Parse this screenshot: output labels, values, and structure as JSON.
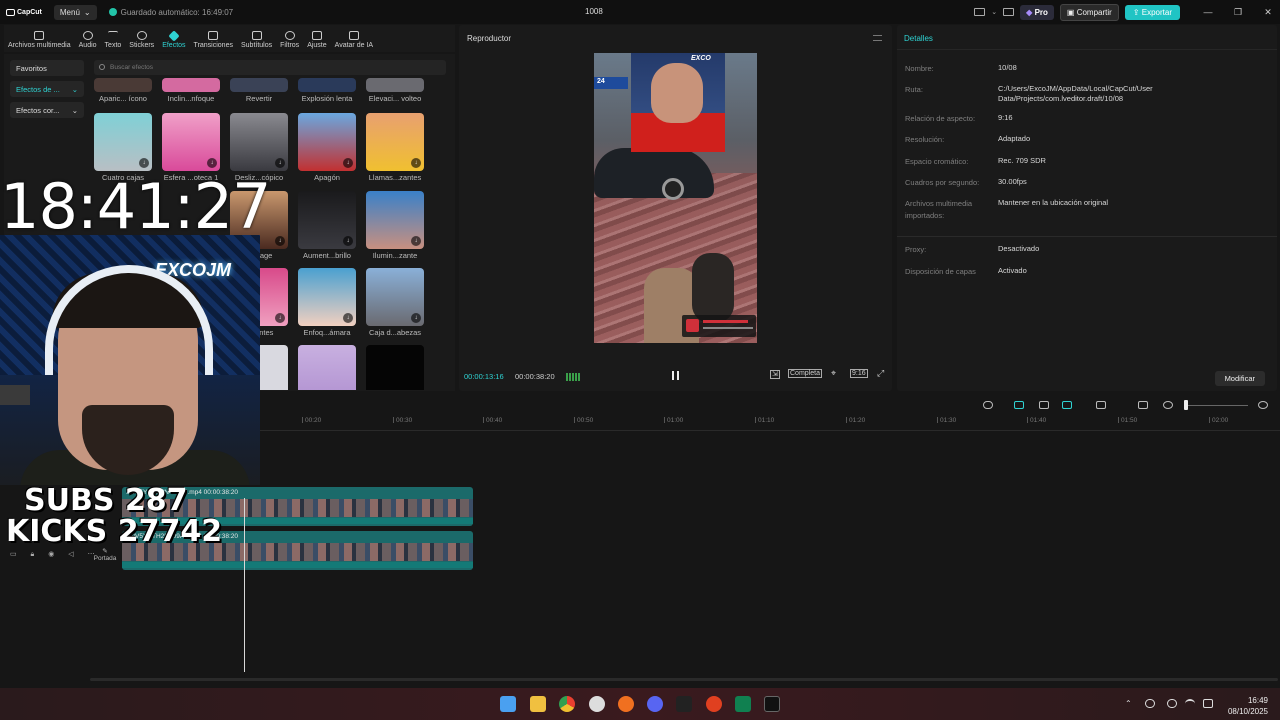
{
  "titlebar": {
    "logo": "CapCut",
    "menu_label": "Menú",
    "autosave": "Guardado automático: 16:49:07",
    "project_title": "1008",
    "pro_label": "Pro",
    "share_label": "Compartir",
    "export_label": "Exportar"
  },
  "toolbar": {
    "items": [
      "Archivos multimedia",
      "Audio",
      "Texto",
      "Stickers",
      "Efectos",
      "Transiciones",
      "Subtítulos",
      "Filtros",
      "Ajuste",
      "Avatar de IA"
    ],
    "active": "Efectos"
  },
  "effects": {
    "sidebar": [
      "Favoritos",
      "Efectos de ...",
      "Efectos cor..."
    ],
    "search_placeholder": "Buscar efectos",
    "row0": [
      "Aparic... ícono",
      "Inclin...nfoque",
      "Revertir",
      "Explosión lenta",
      "Elevaci... volteo"
    ],
    "row1": [
      "Cuatro cajas",
      "Esfera ...oteca 1",
      "Desliz...cópico",
      "Apagón",
      "Llamas...zantes"
    ],
    "row2": [
      "...intage",
      "Aument...brillo",
      "Ilumin...zante"
    ],
    "row3": [
      "...eantes",
      "Enfoq...ámara",
      "Caja d...abezas"
    ]
  },
  "player": {
    "title": "Reproductor",
    "current_time": "00:00:13:16",
    "total_time": "00:00:38:20",
    "fit_label": "Completa",
    "ratio_label": "9:16",
    "video_badge": "24",
    "video_sign": "EXCO"
  },
  "details": {
    "title": "Detalles",
    "rows": [
      {
        "k": "Nombre:",
        "v": "10/08"
      },
      {
        "k": "Ruta:",
        "v": "C:/Users/ExcoJM/AppData/Local/CapCut/User Data/Projects/com.lveditor.draft/10/08"
      },
      {
        "k": "Relación de aspecto:",
        "v": "9:16"
      },
      {
        "k": "Resolución:",
        "v": "Adaptado"
      },
      {
        "k": "Espacio cromático:",
        "v": "Rec. 709 SDR"
      },
      {
        "k": "Cuadros por segundo:",
        "v": "30.00fps"
      },
      {
        "k": "Archivos multimedia importados:",
        "v": "Mantener en la ubicación original"
      },
      {
        "k": "Proxy:",
        "v": "Desactivado"
      },
      {
        "k": "Disposición de capas",
        "v": "Activado"
      }
    ],
    "modify_label": "Modificar"
  },
  "timeline": {
    "ticks": [
      "00:20",
      "00:30",
      "00:40",
      "00:50",
      "01:00",
      "01:10",
      "01:20",
      "01:30",
      "01:40",
      "01:50",
      "02:00"
    ],
    "clip1_name": "...9V5YHTH2N409AJ.mp4   00:00:38:20",
    "clip2_name": "...9V5YHTH2N409AJ.mp4   00:00:38:20",
    "cover_label": "Portada"
  },
  "overlay": {
    "clock": "18:41:27",
    "subs": "SUBS 287",
    "kicks": "KICKS 27742",
    "cam_sign": "EXCOJM"
  },
  "taskbar": {
    "time": "16:49",
    "date": "08/10/2025"
  },
  "colors": {
    "accent": "#2fd3d3",
    "clip": "#1b6a6a",
    "export": "#20c4c4"
  }
}
